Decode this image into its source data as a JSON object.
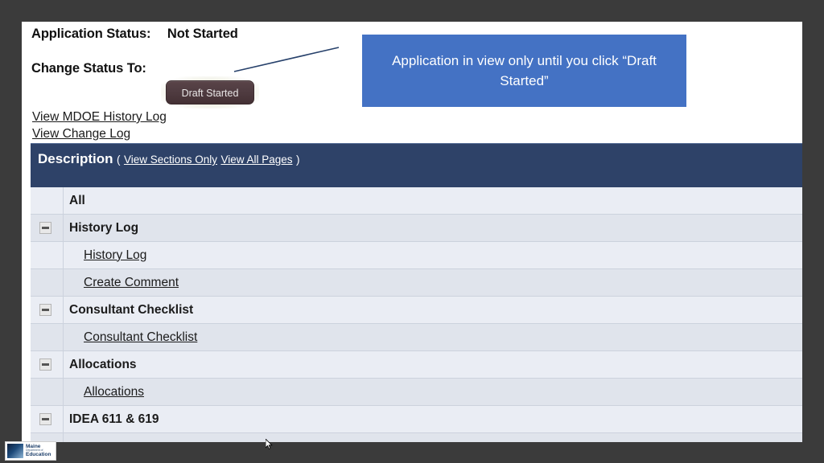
{
  "colors": {
    "slide_background": "#3b3b3b",
    "panel_background": "#ffffff",
    "callout_blue": "#4472c4",
    "header_navy": "#2e4268",
    "button_maroon": "#503c41",
    "row_shade_a": "#eaedf4",
    "row_shade_b": "#e0e4ec"
  },
  "status": {
    "application_status_label": "Application Status:",
    "application_status_value": "Not Started",
    "change_status_label": "Change Status To:",
    "draft_button_label": "Draft Started"
  },
  "callout": {
    "text": "Application in view only until you click “Draft Started”"
  },
  "links": {
    "view_mdoe_history_log": "View MDOE History Log",
    "view_change_log": "View Change Log"
  },
  "description_bar": {
    "title": "Description",
    "paren_open": "(",
    "view_sections_only": "View Sections Only",
    "view_all_pages": "View All Pages",
    "paren_close": ")"
  },
  "tree": {
    "rows": [
      {
        "label": "All",
        "level": 0,
        "toggle": false,
        "shade": "a"
      },
      {
        "label": "History Log",
        "level": 0,
        "toggle": true,
        "shade": "b"
      },
      {
        "label": "History Log",
        "level": 1,
        "toggle": false,
        "shade": "a"
      },
      {
        "label": "Create Comment",
        "level": 1,
        "toggle": false,
        "shade": "b"
      },
      {
        "label": "Consultant Checklist",
        "level": 0,
        "toggle": true,
        "shade": "a"
      },
      {
        "label": "Consultant Checklist",
        "level": 1,
        "toggle": false,
        "shade": "b"
      },
      {
        "label": "Allocations",
        "level": 0,
        "toggle": true,
        "shade": "a"
      },
      {
        "label": "Allocations",
        "level": 1,
        "toggle": false,
        "shade": "b"
      },
      {
        "label": "IDEA 611 & 619",
        "level": 0,
        "toggle": true,
        "shade": "a"
      },
      {
        "label": "",
        "level": 1,
        "toggle": false,
        "shade": "b"
      }
    ]
  },
  "logo": {
    "line1": "Maine",
    "line2": "Department of",
    "line3": "Education"
  }
}
